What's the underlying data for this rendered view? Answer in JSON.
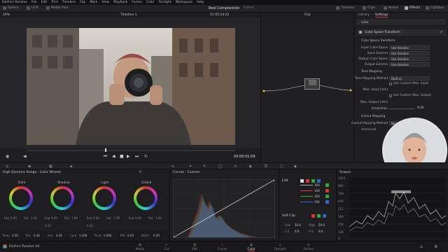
{
  "menubar": {
    "items": [
      "DaVinci Resolve",
      "File",
      "Edit",
      "Trim",
      "Timeline",
      "Clip",
      "Mark",
      "View",
      "Playback",
      "Fusion",
      "Color",
      "Fairlight",
      "Workspace",
      "Help"
    ]
  },
  "toolbar": {
    "left": [
      "Gallery",
      "LUTs",
      "Media Pool"
    ],
    "project": "Reel Composición",
    "project_status": "Edited",
    "right": [
      "Timeline",
      "Clips",
      "Nodes",
      "Effects",
      "Lightbox"
    ]
  },
  "viewer": {
    "zoom": "29%",
    "timeline": "Timeline 1",
    "timecode": "11:05:14:22",
    "clip_menu": "Clip",
    "playhead_tc": "00:00:01:09"
  },
  "inspector": {
    "tabs": [
      "Library",
      "Settings"
    ],
    "search": "color",
    "effect_title": "Color Space Transform",
    "section_cst": "Color Space Transform",
    "rows": [
      {
        "label": "Input Color Space",
        "value": "Use timeline"
      },
      {
        "label": "Input Gamma",
        "value": "Use timeline"
      },
      {
        "label": "Output Color Space",
        "value": "Use timeline"
      },
      {
        "label": "Output Gamma",
        "value": "Use timeline"
      }
    ],
    "section_tone": "Tone Mapping",
    "tone_method_label": "Tone Mapping Method",
    "tone_method": "DaVinci",
    "custom_max_input": "Use Custom Max. Input",
    "max_input_label": "Max. Input (nits)",
    "custom_max_output": "Use Custom Max. Output",
    "max_output_label": "Max. Output (nits)",
    "adaptation_label": "Adaptation",
    "adaptation_value": "9.00",
    "section_gamut": "Gamut Mapping",
    "gamut_method_label": "Gamut Mapping Method",
    "gamut_method": "None",
    "section_advanced": "Advanced"
  },
  "wheels": {
    "title": "High Dynamic Range - Color Wheels",
    "names": [
      "Dark",
      "Shadow",
      "Light",
      "Global"
    ],
    "exp": "0.00",
    "sat": "1.00",
    "footer": [
      {
        "label": "Temp",
        "value": "0.00"
      },
      {
        "label": "Tint",
        "value": "0.00"
      },
      {
        "label": "Hue",
        "value": "0.00"
      },
      {
        "label": "Cont",
        "value": "1.000"
      },
      {
        "label": "Pivot",
        "value": "0.000"
      },
      {
        "label": "MD",
        "value": "0.00"
      },
      {
        "label": "B/Ofs",
        "value": "0.00"
      }
    ],
    "shadow_cv": "0.22",
    "light_cv": "0.22"
  },
  "curves": {
    "title": "Curves - Custom"
  },
  "rgb": {
    "edit_label": "Edit",
    "channel_values": [
      "100",
      "100",
      "100",
      "100"
    ],
    "soft_clip": "Soft Clip",
    "low": "Low",
    "low_value": "50.0",
    "high": "High",
    "high_value": "50.0",
    "ls": "L.S.",
    "hs": "H.S.",
    "soft_values": [
      "0.0",
      "0.0"
    ]
  },
  "scopes": {
    "title": "Scopes",
    "ticks": [
      "1023",
      "896",
      "768",
      "640",
      "512",
      "384",
      "256",
      "128",
      "0"
    ]
  },
  "pages": {
    "app": "DaVinci Resolve 18",
    "items": [
      "Media",
      "Cut",
      "Edit",
      "Fusion",
      "Color",
      "Fairlight",
      "Deliver"
    ],
    "active": "Color"
  },
  "colors": {
    "accent": "#e0464a",
    "active_tab": "#d33a3e"
  }
}
